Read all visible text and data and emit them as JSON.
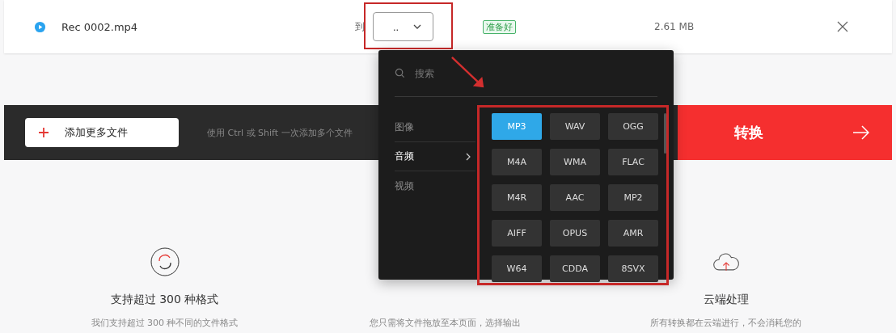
{
  "file": {
    "name": "Rec 0002.mp4",
    "to_label": "到",
    "format_value": "..",
    "status": "准备好",
    "size": "2.61 MB"
  },
  "toolbar": {
    "add_button": "添加更多文件",
    "hint": "使用 Ctrl 或 Shift 一次添加多个文件",
    "convert_button": "转换"
  },
  "dropdown": {
    "search_placeholder": "搜索",
    "categories": [
      {
        "label": "图像",
        "selected": false
      },
      {
        "label": "音频",
        "selected": true
      },
      {
        "label": "视频",
        "selected": false
      }
    ],
    "formats": [
      {
        "label": "MP3",
        "selected": true
      },
      {
        "label": "WAV",
        "selected": false
      },
      {
        "label": "OGG",
        "selected": false
      },
      {
        "label": "M4A",
        "selected": false
      },
      {
        "label": "WMA",
        "selected": false
      },
      {
        "label": "FLAC",
        "selected": false
      },
      {
        "label": "M4R",
        "selected": false
      },
      {
        "label": "AAC",
        "selected": false
      },
      {
        "label": "MP2",
        "selected": false
      },
      {
        "label": "AIFF",
        "selected": false
      },
      {
        "label": "OPUS",
        "selected": false
      },
      {
        "label": "AMR",
        "selected": false
      },
      {
        "label": "W64",
        "selected": false
      },
      {
        "label": "CDDA",
        "selected": false
      },
      {
        "label": "8SVX",
        "selected": false
      }
    ]
  },
  "features": [
    {
      "kind": "formats",
      "title": "支持超过 300 种格式",
      "description": "我们支持超过 300 种不同的文件格式"
    },
    {
      "kind": "hidden",
      "description": "您只需将文件拖放至本页面，选择输出"
    },
    {
      "kind": "cloud",
      "title": "云端处理",
      "description": "所有转换都在云端进行，不会消耗您的"
    }
  ]
}
